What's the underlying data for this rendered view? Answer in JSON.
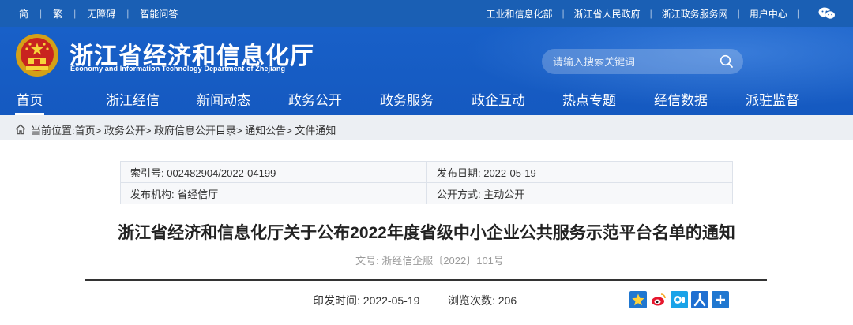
{
  "topbar": {
    "left": [
      "简",
      "繁",
      "无障碍",
      "智能问答"
    ],
    "right": [
      "工业和信息化部",
      "浙江省人民政府",
      "浙江政务服务网",
      "用户中心"
    ],
    "wechat_icon": "wechat-icon"
  },
  "header": {
    "title": "浙江省经济和信息化厅",
    "subtitle": "Economy and Information Technology Department of Zhejiang",
    "search_placeholder": "请输入搜索关键词"
  },
  "nav": {
    "items": [
      "首页",
      "浙江经信",
      "新闻动态",
      "政务公开",
      "政务服务",
      "政企互动",
      "热点专题",
      "经信数据",
      "派驻监督"
    ],
    "active": "首页"
  },
  "breadcrumb": {
    "text": "当前位置:首页> 政务公开> 政府信息公开目录> 通知公告> 文件通知"
  },
  "meta": {
    "index_no": "索引号: 002482904/2022-04199",
    "publish_date": "发布日期: 2022-05-19",
    "issuer": "发布机构: 省经信厅",
    "public_mode": "公开方式: 主动公开"
  },
  "doc": {
    "title": "浙江省经济和信息化厅关于公布2022年度省级中小企业公共服务示范平台名单的通知",
    "number": "文号: 浙经信企服〔2022〕101号",
    "print_time": "印发时间: 2022-05-19",
    "views": "浏览次数: 206"
  },
  "colors": {
    "brand_blue": "#1a5fb4",
    "crumb_bg": "#eceff3"
  }
}
